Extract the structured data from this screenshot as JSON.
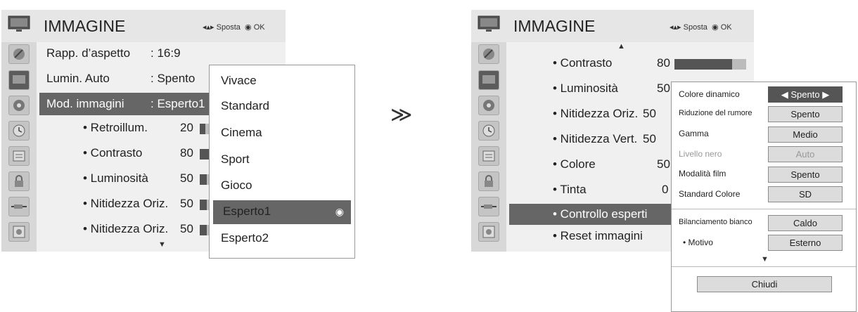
{
  "left": {
    "title": "IMMAGINE",
    "nav": {
      "move_label": "Sposta",
      "ok_label": "OK"
    },
    "menu": [
      {
        "label": "Rapp. d’aspetto",
        "value": ": 16:9"
      },
      {
        "label": "Lumin. Auto",
        "value": ": Spento"
      },
      {
        "label": "Mod. immagini",
        "value": ": Esperto1"
      }
    ],
    "sub": [
      {
        "label": "• Retroillum.",
        "value": "20",
        "level": 20
      },
      {
        "label": "• Contrasto",
        "value": "80",
        "level": 80
      },
      {
        "label": "• Luminosità",
        "value": "50",
        "level": 50
      },
      {
        "label": "• Nitidezza Oriz.",
        "value": "50",
        "level": 50
      },
      {
        "label": "• Nitidezza Oriz.",
        "value": "50",
        "level": 50
      }
    ],
    "popup": [
      "Vivace",
      "Standard",
      "Cinema",
      "Sport",
      "Gioco",
      "Esperto1",
      "Esperto2"
    ],
    "popup_selected": "Esperto1"
  },
  "right": {
    "title": "IMMAGINE",
    "nav": {
      "move_label": "Sposta",
      "ok_label": "OK"
    },
    "items": [
      {
        "label": "• Contrasto",
        "value": "80",
        "level": 80
      },
      {
        "label": "• Luminosità",
        "value": "50",
        "level": 50
      },
      {
        "label": "• Nitidezza Oriz.",
        "value": "50",
        "level": 50
      },
      {
        "label": "• Nitidezza Vert.",
        "value": "50",
        "level": 50
      },
      {
        "label": "• Colore",
        "value": "50",
        "level": 50
      },
      {
        "label": "• Tinta",
        "value": "0",
        "level": 50
      }
    ],
    "selected": "• Controllo esperti",
    "reset": "• Reset immagini",
    "expert": {
      "rows": [
        {
          "label": "Colore dinamico",
          "value": "Spento",
          "active": true
        },
        {
          "label": "Riduzione del rumore",
          "value": "Spento"
        },
        {
          "label": "Gamma",
          "value": "Medio"
        },
        {
          "label": "Livello nero",
          "value": "Auto",
          "disabled": true
        },
        {
          "label": "Modalità film",
          "value": "Spento"
        },
        {
          "label": "Standard Colore",
          "value": "SD"
        },
        {
          "label": "Bilanciamento bianco",
          "value": "Caldo"
        },
        {
          "label": "• Motivo",
          "value": "Esterno"
        }
      ],
      "close": "Chiudi"
    }
  },
  "transition_symbol": "≫",
  "colors": {
    "highlight": "#666666",
    "header": "#e6e6e6",
    "sidebar": "#d8d8d8"
  }
}
